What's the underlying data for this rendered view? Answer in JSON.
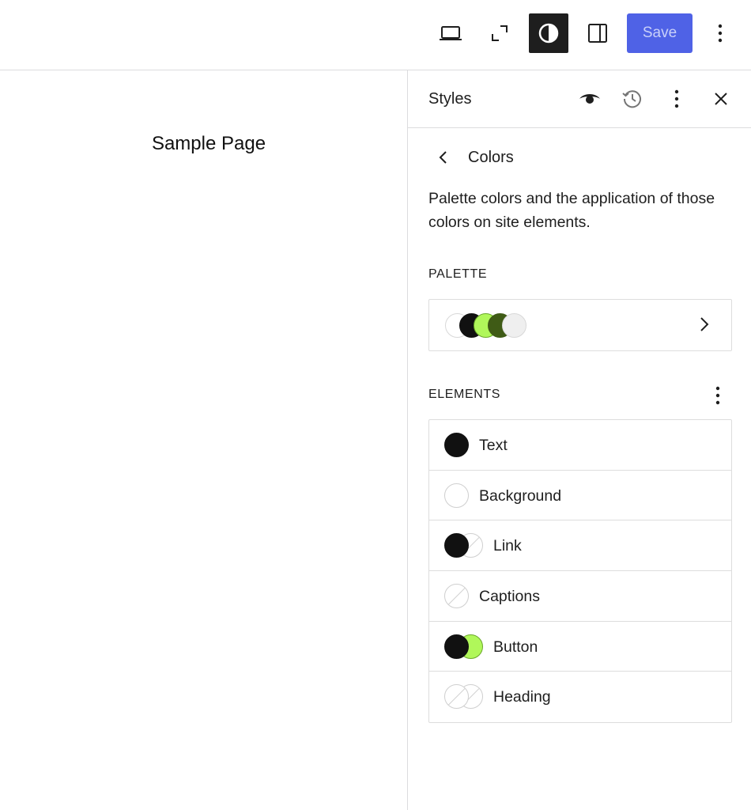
{
  "toolbar": {
    "icons": [
      "desktop-view-icon",
      "fullscreen-icon",
      "styles-icon",
      "sidebar-toggle-icon",
      "more-options-icon"
    ],
    "save_label": "Save",
    "accent_color": "#4f62e6"
  },
  "canvas": {
    "page_title": "Sample Page"
  },
  "sidebar": {
    "title": "Styles",
    "header_icons": [
      "eye-icon",
      "revisions-icon",
      "more-options-icon",
      "close-icon"
    ],
    "panel": {
      "title": "Colors",
      "description": "Palette colors and the application of those colors on site elements."
    },
    "palette": {
      "label": "PALETTE",
      "swatches": [
        "#ffffff",
        "#111111",
        "#b0f75a",
        "#3f5b16",
        "#efefef"
      ]
    },
    "elements": {
      "label": "ELEMENTS",
      "items": [
        {
          "label": "Text",
          "colors": [
            "#111111"
          ]
        },
        {
          "label": "Background",
          "colors": [
            "#ffffff"
          ]
        },
        {
          "label": "Link",
          "colors": [
            "#111111",
            "none"
          ]
        },
        {
          "label": "Captions",
          "colors": [
            "none"
          ]
        },
        {
          "label": "Button",
          "colors": [
            "#111111",
            "#b0f75a"
          ]
        },
        {
          "label": "Heading",
          "colors": [
            "none",
            "none"
          ]
        }
      ]
    }
  }
}
